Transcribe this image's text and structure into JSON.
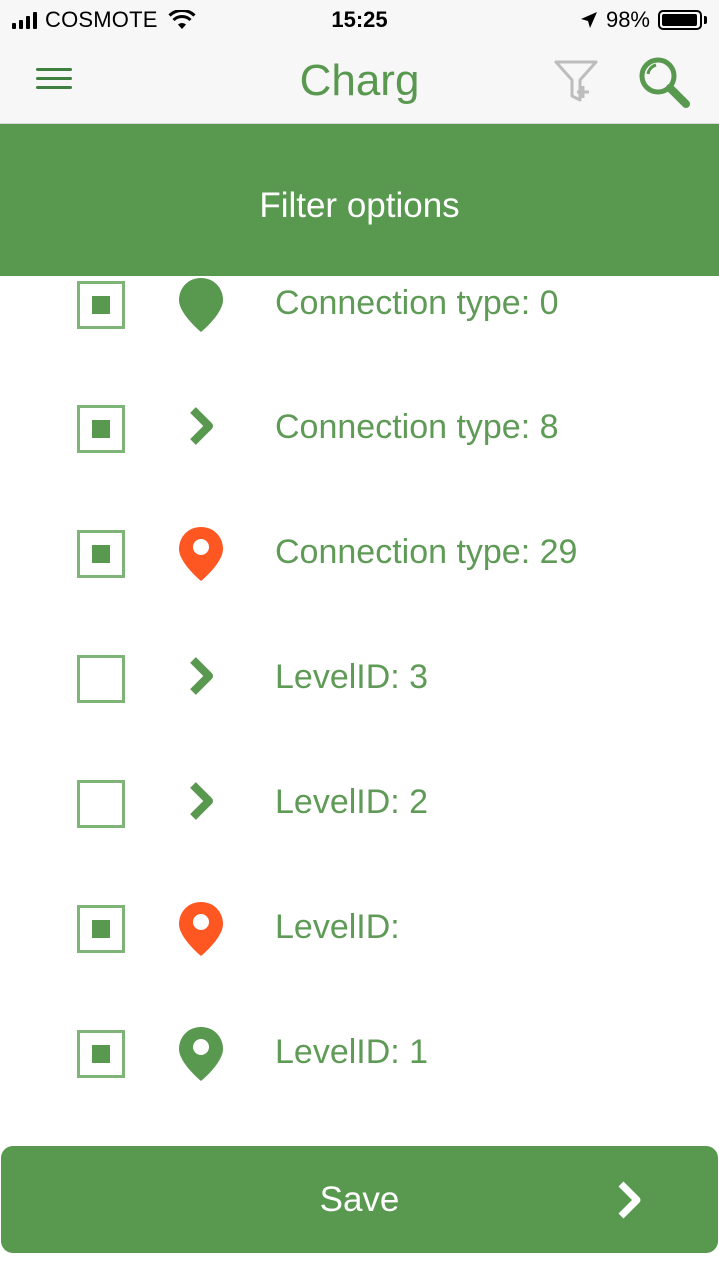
{
  "status_bar": {
    "carrier": "COSMOTE",
    "time": "15:25",
    "battery": "98%"
  },
  "nav": {
    "title": "Charg",
    "menu_icon": "hamburger-menu-icon",
    "filter_icon": "filter-add-icon",
    "search_icon": "search-icon"
  },
  "header": {
    "title": "Filter options"
  },
  "filters": [
    {
      "label": "Connection type: 0",
      "checked": true,
      "icon": "map-pin-solid-icon",
      "icon_color": "#58984f"
    },
    {
      "label": "Connection type: 8",
      "checked": true,
      "icon": "chevron-right-icon",
      "icon_color": "#58984f"
    },
    {
      "label": "Connection type: 29",
      "checked": true,
      "icon": "map-pin-icon",
      "icon_color": "#ff5722"
    },
    {
      "label": "LevelID: 3",
      "checked": false,
      "icon": "chevron-right-icon",
      "icon_color": "#58984f"
    },
    {
      "label": "LevelID: 2",
      "checked": false,
      "icon": "chevron-right-icon",
      "icon_color": "#58984f"
    },
    {
      "label": "LevelID:",
      "checked": true,
      "icon": "map-pin-icon",
      "icon_color": "#ff5722"
    },
    {
      "label": "LevelID: 1",
      "checked": true,
      "icon": "map-pin-icon",
      "icon_color": "#58984f"
    }
  ],
  "save": {
    "label": "Save",
    "icon": "chevron-right-icon"
  },
  "colors": {
    "primary": "#58984f",
    "accent_orange": "#ff5722",
    "text_green": "#5f9b57"
  }
}
